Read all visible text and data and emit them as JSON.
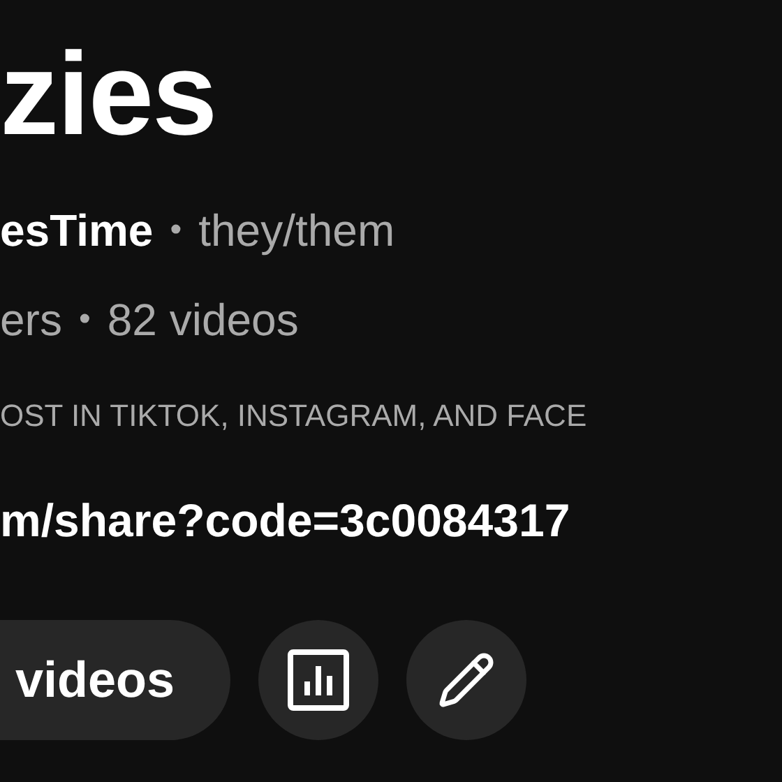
{
  "channel": {
    "title": "zies",
    "handle": "esTime",
    "separator_1": "•",
    "pronouns": "they/them",
    "subscribers": "ers",
    "separator_2": "•",
    "videos_count": "82 videos",
    "description": "OST IN TIKTOK, INSTAGRAM, AND FACE",
    "link": "m/share?code=3c0084317"
  },
  "actions": [
    {
      "kind": "text",
      "label": "videos"
    },
    {
      "kind": "analytics"
    },
    {
      "kind": "edit"
    }
  ]
}
